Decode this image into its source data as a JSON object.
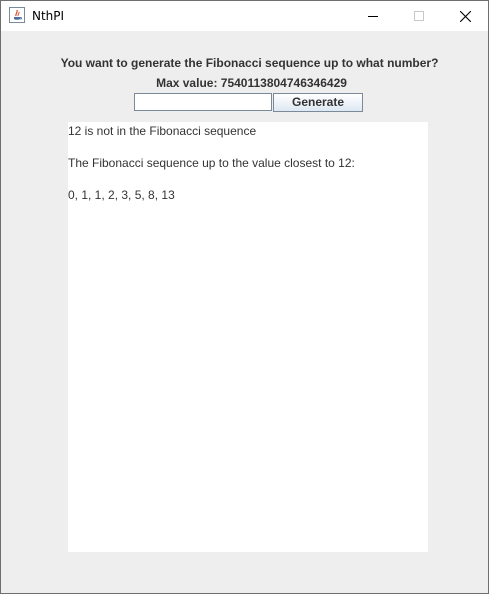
{
  "window": {
    "title": "NthPI",
    "icon": "java-icon"
  },
  "controls": {
    "minimize_icon": "minimize-icon",
    "maximize_icon": "maximize-icon",
    "close_icon": "close-icon"
  },
  "form": {
    "prompt": "You want to generate the Fibonacci sequence up to what number?",
    "max_value_label": "Max value:",
    "max_value": "7540113804746346429",
    "input_value": "",
    "generate_label": "Generate"
  },
  "output": {
    "line1": "12 is not in the Fibonacci sequence",
    "line2": "The Fibonacci sequence up to the value closest to 12:",
    "line3": "0, 1, 1, 2, 3, 5, 8, 13"
  }
}
